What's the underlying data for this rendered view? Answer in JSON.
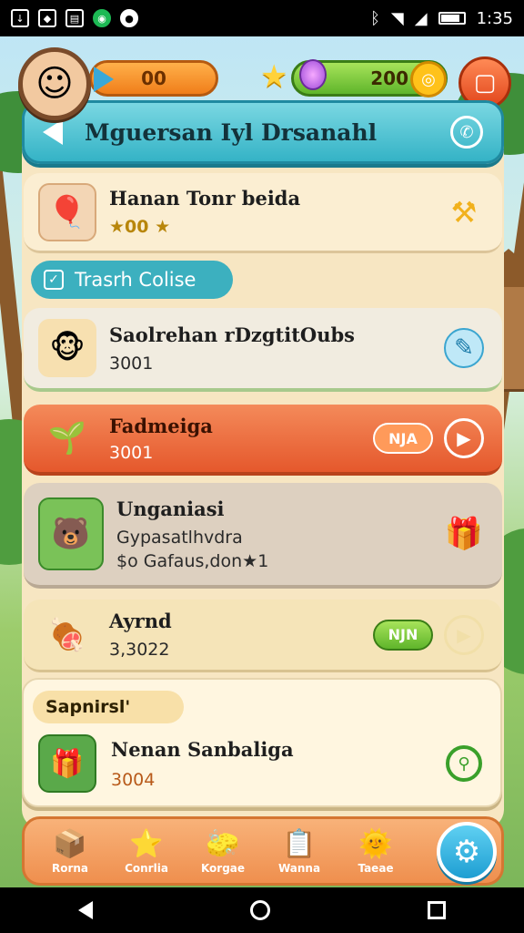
{
  "status_bar": {
    "time": "1:35",
    "icons": [
      "download-icon",
      "app-icon",
      "notes-icon",
      "spotify-icon",
      "record-icon"
    ],
    "right_icons": [
      "bluetooth-icon",
      "wifi-icon",
      "signal-icon",
      "battery-icon"
    ]
  },
  "hud": {
    "left_counter": "00",
    "right_counter": "200"
  },
  "title": "Mguersan Iyl Drsanahl",
  "rows": [
    {
      "title": "Hanan Tonr beida",
      "sub": "★00 ★"
    },
    {
      "title": "Saolrehan rDzgtitOubs",
      "sub": "3001"
    },
    {
      "title": "Fadmeiga",
      "sub": "3001",
      "pill": "NJA"
    },
    {
      "title": "Unganiasi",
      "sub": "Gypasatlhvdra",
      "sub2": "$o Gafaus,don★1"
    },
    {
      "title": "Ayrnd",
      "sub": "3,3022",
      "pill": "NJN"
    }
  ],
  "section_tag": "Trasrh Colise",
  "card": {
    "tag": "Sapnirsl'",
    "title": "Nenan Sanbaliga",
    "sub": "3004"
  },
  "tabs": [
    {
      "label": "Rorna"
    },
    {
      "label": "Conrlia"
    },
    {
      "label": "Korgae"
    },
    {
      "label": "Wanna"
    },
    {
      "label": "Taeae"
    }
  ],
  "colors": {
    "title_bar": "#34b3c6",
    "accent_orange": "#e5582c",
    "accent_green": "#5fb52b"
  }
}
